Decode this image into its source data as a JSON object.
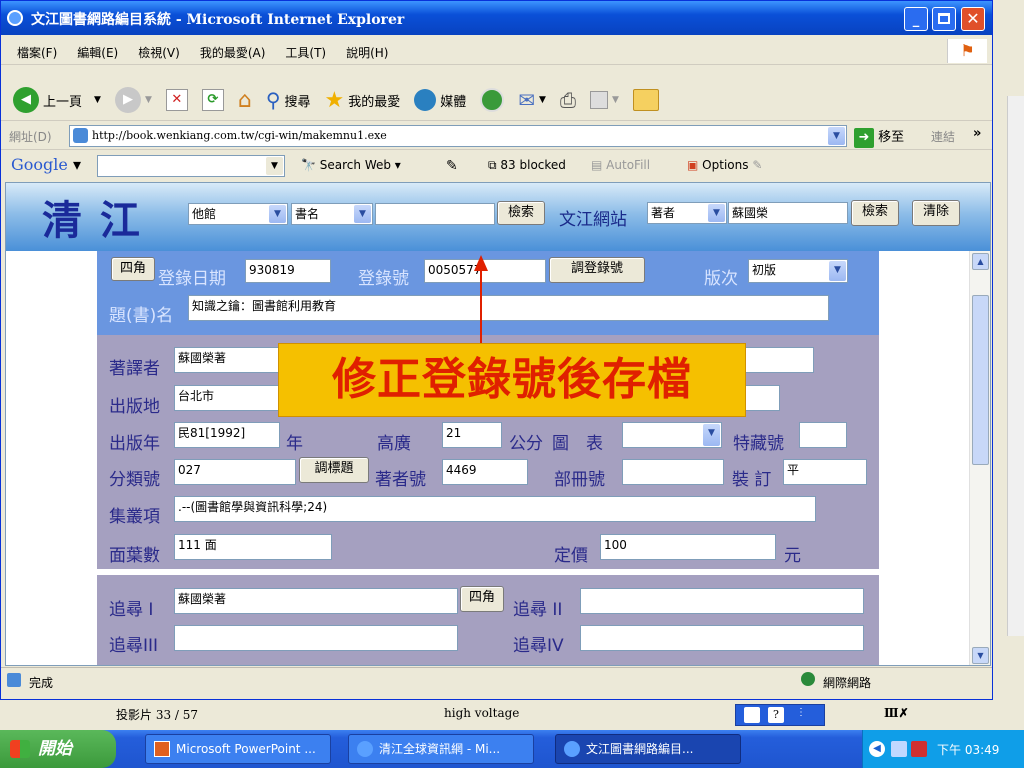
{
  "window": {
    "title": "文江圖書網路編目系統 - Microsoft Internet Explorer"
  },
  "menu": [
    "檔案(F)",
    "編輯(E)",
    "檢視(V)",
    "我的最愛(A)",
    "工具(T)",
    "說明(H)"
  ],
  "toolbar": {
    "back": "上一頁",
    "search": "搜尋",
    "favorites": "我的最愛",
    "media": "媒體"
  },
  "address": {
    "label": "網址(D)",
    "url": "http://book.wenkiang.com.tw/cgi-win/makemnu1.exe",
    "go": "移至",
    "links": "連結"
  },
  "google": {
    "logo": "Google",
    "search_web": "Search Web",
    "blocked": "83 blocked",
    "autofill": "AutoFill",
    "options": "Options"
  },
  "brand": {
    "logo": "清 江",
    "library": "他館",
    "field1": "書名",
    "search_btn": "檢索",
    "site_label": "文江網站",
    "field2": "著者",
    "query2": "蘇國榮",
    "search_btn2": "檢索",
    "clear_btn": "清除"
  },
  "form": {
    "four_corner": "四角",
    "reg_date_label": "登錄日期",
    "reg_date": "930819",
    "reg_no_label": "登錄號",
    "reg_no": "0050577",
    "adjust_reg_btn": "調登錄號",
    "edition_label": "版次",
    "edition": "初版",
    "title_label": "題(書)名",
    "title": "知識之鑰：圖書館利用教育",
    "author_label": "著譯者",
    "author": "蘇國榮著",
    "place_label": "出版地",
    "place": "台北市",
    "year_label": "出版年",
    "year": "民81[1992]",
    "year_unit": "年",
    "height_label": "高廣",
    "height": "21",
    "height_unit": "公分",
    "illus_label": "圖　表",
    "special_label": "特藏號",
    "class_label": "分類號",
    "class_no": "027",
    "adjust_title_btn": "調標題",
    "author_no_label": "著者號",
    "author_no": "4469",
    "volume_label": "部冊號",
    "binding_label": "裝 訂",
    "binding": "平",
    "series_label": "集叢項",
    "series": ".--(圖書館學與資訊科學;24)",
    "pages_label": "面葉數",
    "pages": "111 面",
    "price_label": "定價",
    "price": "100",
    "price_unit": "元",
    "trace1_label": "追尋 I",
    "trace1": "蘇國榮著",
    "four_corner2": "四角",
    "trace2_label": "追尋 II",
    "trace3_label": "追尋III",
    "trace4_label": "追尋IV"
  },
  "annotation": "修正登錄號後存檔",
  "status": {
    "text": "完成",
    "zone": "網際網路"
  },
  "ppt": {
    "slide": "投影片 33 / 57",
    "theme": "high voltage"
  },
  "taskbar": {
    "start": "開始",
    "items": [
      "Microsoft PowerPoint ...",
      "清江全球資訊網 - Mi...",
      "文江圖書網路編目..."
    ],
    "clock": "下午 03:49"
  },
  "colors": {
    "titlebar": "#0a50d8",
    "form_top": "#6a96e0",
    "form_body": "#a5a0c0",
    "taskbar": "#245edb",
    "start": "#3c9a3c",
    "annotation_bg": "#f5c000",
    "annotation_text": "#e02000"
  }
}
